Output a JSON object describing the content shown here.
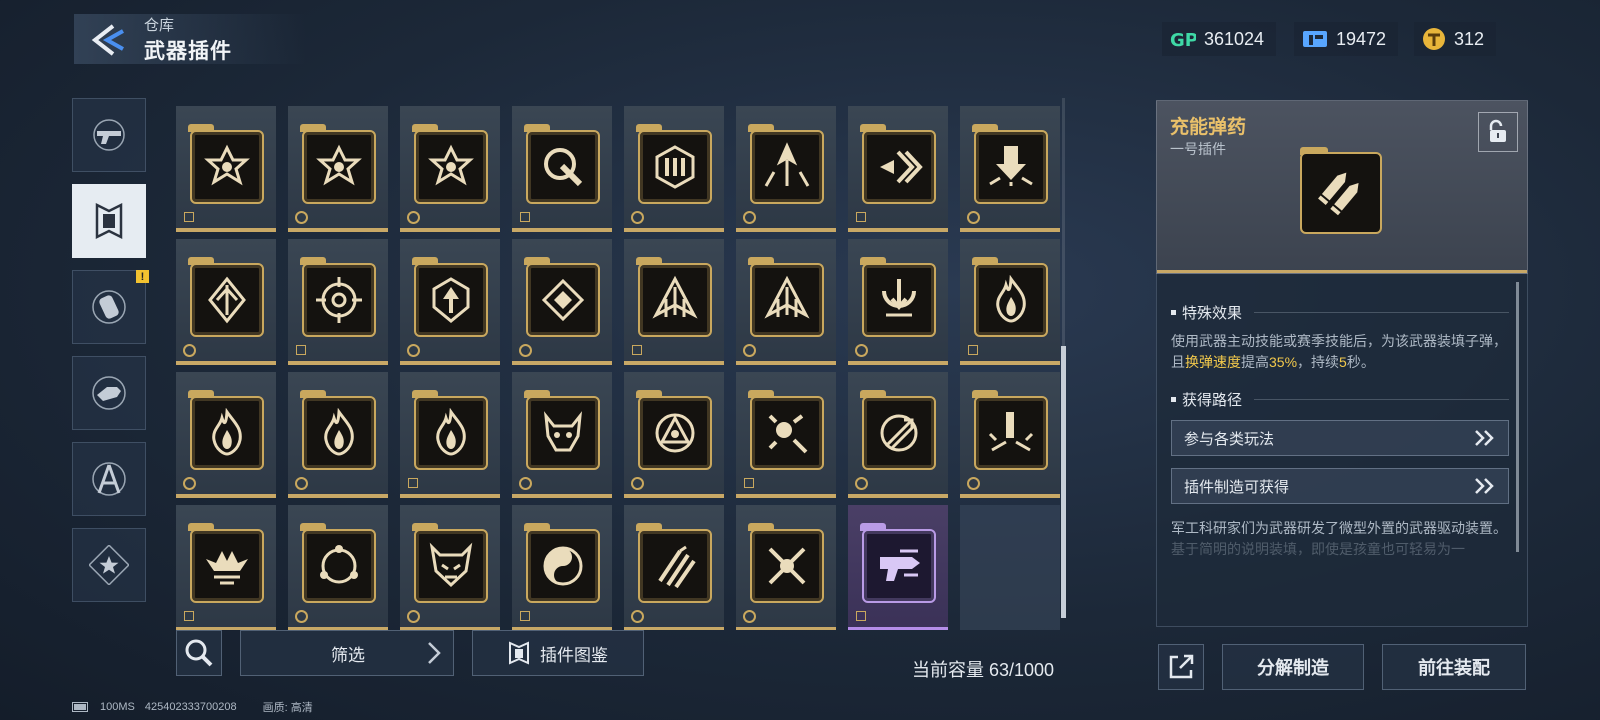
{
  "header": {
    "category": "仓库",
    "title": "武器插件"
  },
  "currencies": [
    {
      "icon": "gp-icon",
      "value": "361024"
    },
    {
      "icon": "ticket-icon",
      "value": "19472"
    },
    {
      "icon": "token-icon",
      "value": "312"
    }
  ],
  "sidebar": {
    "tabs": [
      {
        "name": "weapon-tab",
        "icon": "gun-icon",
        "active": false
      },
      {
        "name": "plugin-tab",
        "icon": "plugin-chip-icon",
        "active": true
      },
      {
        "name": "canister-tab",
        "icon": "canister-icon",
        "active": false,
        "alert": "!"
      },
      {
        "name": "gear-tab",
        "icon": "hand-gear-icon",
        "active": false
      },
      {
        "name": "tool-tab",
        "icon": "compass-icon",
        "active": false
      },
      {
        "name": "badge-tab",
        "icon": "star-badge-icon",
        "active": false
      }
    ]
  },
  "plugins": [
    {
      "icon": "star-emblem-icon",
      "rarity": "gold"
    },
    {
      "icon": "star-emblem-icon",
      "rarity": "gold"
    },
    {
      "icon": "star-emblem-icon",
      "rarity": "gold"
    },
    {
      "icon": "ring-slash-icon",
      "rarity": "gold"
    },
    {
      "icon": "hexagon-ammo-icon",
      "rarity": "gold"
    },
    {
      "icon": "burst-arrow-icon",
      "rarity": "gold"
    },
    {
      "icon": "bullet-chevron-icon",
      "rarity": "gold"
    },
    {
      "icon": "impact-down-icon",
      "rarity": "gold"
    },
    {
      "icon": "diamond-arrow-icon",
      "rarity": "gold"
    },
    {
      "icon": "crosshair-icon",
      "rarity": "gold"
    },
    {
      "icon": "shield-arrow-icon",
      "rarity": "gold"
    },
    {
      "icon": "diamond-frame-icon",
      "rarity": "gold"
    },
    {
      "icon": "triple-arrow-icon",
      "rarity": "gold"
    },
    {
      "icon": "triple-arrow-icon",
      "rarity": "gold"
    },
    {
      "icon": "magnet-shot-icon",
      "rarity": "gold"
    },
    {
      "icon": "flame-icon",
      "rarity": "gold"
    },
    {
      "icon": "flame-icon",
      "rarity": "gold"
    },
    {
      "icon": "flame-icon",
      "rarity": "gold"
    },
    {
      "icon": "flame-icon",
      "rarity": "gold"
    },
    {
      "icon": "beast-skull-icon",
      "rarity": "gold"
    },
    {
      "icon": "triangle-eye-icon",
      "rarity": "gold"
    },
    {
      "icon": "scatter-burst-icon",
      "rarity": "gold"
    },
    {
      "icon": "ring-arrows-icon",
      "rarity": "gold"
    },
    {
      "icon": "split-impact-icon",
      "rarity": "gold"
    },
    {
      "icon": "spiked-crown-icon",
      "rarity": "gold"
    },
    {
      "icon": "tri-ring-icon",
      "rarity": "gold"
    },
    {
      "icon": "demon-mask-icon",
      "rarity": "gold"
    },
    {
      "icon": "yin-swirl-icon",
      "rarity": "gold"
    },
    {
      "icon": "claw-slash-icon",
      "rarity": "gold"
    },
    {
      "icon": "crossed-burst-icon",
      "rarity": "gold"
    },
    {
      "icon": "pistol-arrow-icon",
      "rarity": "purple"
    },
    {
      "icon": "",
      "rarity": "empty"
    }
  ],
  "bottom": {
    "filter_label": "筛选",
    "codex_label": "插件图鉴",
    "capacity_label": "当前容量 63/1000"
  },
  "footer": {
    "latency": "100MS",
    "uid": "425402333700208",
    "quality": "画质: 高清"
  },
  "detail": {
    "name": "充能弹药",
    "slot": "一号插件",
    "icon": "rocket-ammo-icon",
    "effect_heading": "特殊效果",
    "effect_text_1": "使用武器主动技能或赛季技能后，为该武器装填子弹，且",
    "effect_hl_1": "换弹速度",
    "effect_text_2": "提高",
    "effect_hl_2": "35%",
    "effect_text_3": "，持续",
    "effect_hl_3": "5",
    "effect_text_4": "秒。",
    "source_heading": "获得路径",
    "sources": [
      "参与各类玩法",
      "插件制造可获得"
    ],
    "lore": "军工科研家们为武器研发了微型外置的武器驱动装置。",
    "lore_faded": "基于简明的说明装填，即使是孩童也可轻易为一"
  },
  "actions": {
    "dismantle_label": "分解制造",
    "equip_label": "前往装配"
  },
  "colors": {
    "gold": "#c9a85e",
    "title_gold": "#e9c06a",
    "highlight": "#f2c94c",
    "purple": "#b99be6"
  }
}
